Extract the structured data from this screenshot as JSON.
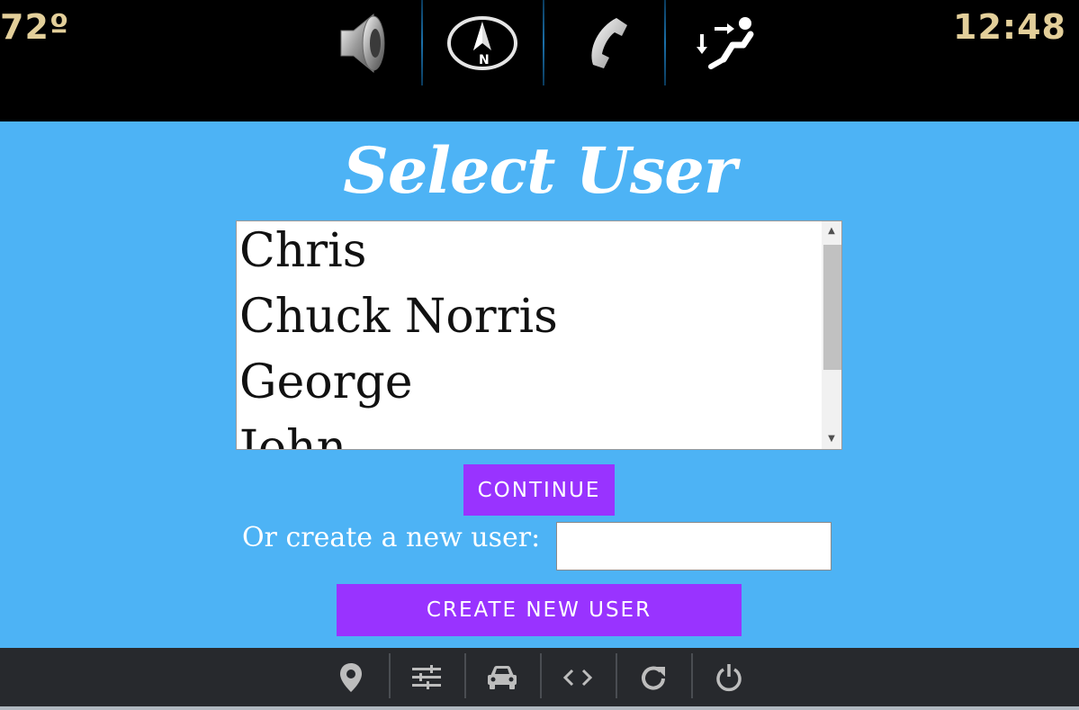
{
  "status_bar": {
    "temperature": "72º",
    "time": "12:48",
    "icons": [
      "speaker-icon",
      "compass-icon",
      "phone-icon",
      "climate-icon"
    ]
  },
  "main": {
    "title": "Select User",
    "users": [
      "Chris",
      "Chuck Norris",
      "George",
      "John"
    ],
    "continue_label": "CONTINUE",
    "new_user_label": "Or create a new user:",
    "new_user_value": "",
    "create_label": "CREATE NEW USER"
  },
  "bottom_nav": {
    "icons": [
      "location-icon",
      "equalizer-icon",
      "car-icon",
      "code-icon",
      "refresh-icon",
      "power-icon"
    ]
  },
  "colors": {
    "background": "#4db3f5",
    "button": "#9933ff",
    "status_text": "#e3cf9a",
    "topbar": "#000000",
    "bottombar": "#27292d"
  }
}
